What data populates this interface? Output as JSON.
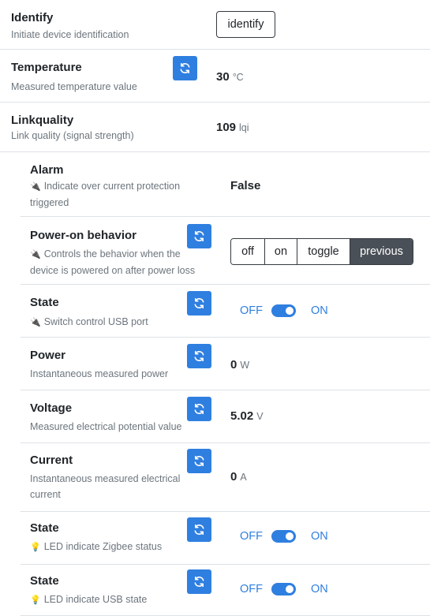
{
  "identify": {
    "title": "Identify",
    "desc": "Initiate device identification",
    "button": "identify"
  },
  "temperature": {
    "title": "Temperature",
    "desc": "Measured temperature value",
    "value": "30",
    "unit": "°C"
  },
  "linkquality": {
    "title": "Linkquality",
    "desc": "Link quality (signal strength)",
    "value": "109",
    "unit": "lqi"
  },
  "alarm": {
    "title": "Alarm",
    "desc_line1": "Indicate over current protection",
    "desc_line2": "triggered",
    "value": "False"
  },
  "power_on": {
    "title": "Power-on behavior",
    "desc_line1": "Controls the behavior when the",
    "desc_line2": "device is powered on after power loss",
    "options": [
      "off",
      "on",
      "toggle",
      "previous"
    ],
    "selected": "previous"
  },
  "state_usb_port": {
    "title": "State",
    "desc": "Switch control USB port",
    "off_label": "OFF",
    "on_label": "ON"
  },
  "power": {
    "title": "Power",
    "desc": "Instantaneous measured power",
    "value": "0",
    "unit": "W"
  },
  "voltage": {
    "title": "Voltage",
    "desc": "Measured electrical potential value",
    "value": "5.02",
    "unit": "V"
  },
  "current": {
    "title": "Current",
    "desc_line1": "Instantaneous measured electrical",
    "desc_line2": "current",
    "value": "0",
    "unit": "A"
  },
  "state_led_zigbee": {
    "title": "State",
    "desc": "LED indicate Zigbee status",
    "off_label": "OFF",
    "on_label": "ON"
  },
  "state_led_usb": {
    "title": "State",
    "desc": "LED indicate USB state",
    "off_label": "OFF",
    "on_label": "ON"
  },
  "icons": {
    "refresh": "refresh-icon",
    "plug": "plug-icon",
    "bulb": "bulb-icon"
  },
  "colors": {
    "accent": "#2f7fe0",
    "active_segment": "#495057"
  }
}
